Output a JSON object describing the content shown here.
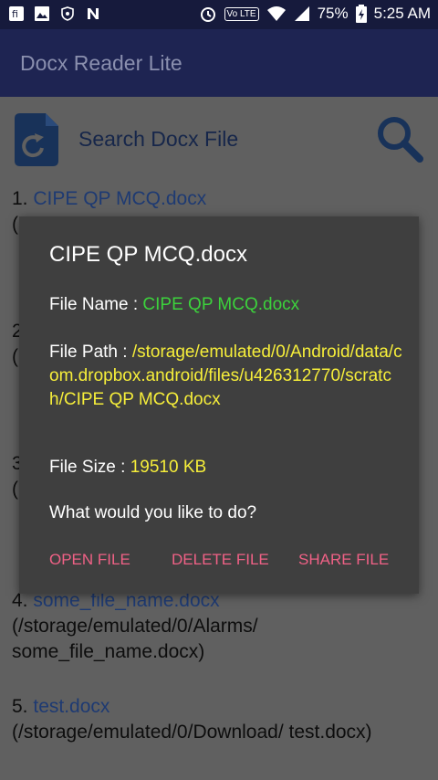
{
  "status_bar": {
    "left_icons": [
      "flipboard-icon",
      "gallery-icon",
      "shield-icon",
      "n-icon"
    ],
    "volte": "Vo LTE",
    "battery": "75%",
    "time": "5:25 AM"
  },
  "app": {
    "title": "Docx Reader Lite"
  },
  "search": {
    "label": "Search Docx File"
  },
  "files": [
    {
      "num": "1.",
      "name": "CIPE QP MCQ.docx",
      "path": "("
    },
    {
      "num": "2",
      "name": "",
      "path": "("
    },
    {
      "num": "3",
      "name": "",
      "path": "("
    },
    {
      "num": "4.",
      "name": "some_file_name.docx",
      "path": "(/storage/emulated/0/Alarms/ some_file_name.docx)"
    },
    {
      "num": "5.",
      "name": "test.docx",
      "path": "(/storage/emulated/0/Download/ test.docx)"
    }
  ],
  "dialog": {
    "title": "CIPE QP MCQ.docx",
    "file_name_label": "File Name : ",
    "file_name_value": "CIPE QP MCQ.docx",
    "file_path_label": "File Path : ",
    "file_path_value": "/storage/emulated/0/Android/data/com.dropbox.android/files/u426312770/scratch/CIPE QP MCQ.docx",
    "file_size_label": "File Size : ",
    "file_size_value": "19510 KB",
    "question": "What would you like to do?",
    "actions": {
      "open": "OPEN FILE",
      "delete": "DELETE FILE",
      "share": "SHARE FILE"
    }
  },
  "colors": {
    "statusbar": "#161a3c",
    "appbar": "#1e2452",
    "dialog_bg": "#3f3f3f",
    "accent_pink": "#f06186",
    "value_green": "#3cd23c",
    "value_yellow": "#f6ee3a"
  }
}
